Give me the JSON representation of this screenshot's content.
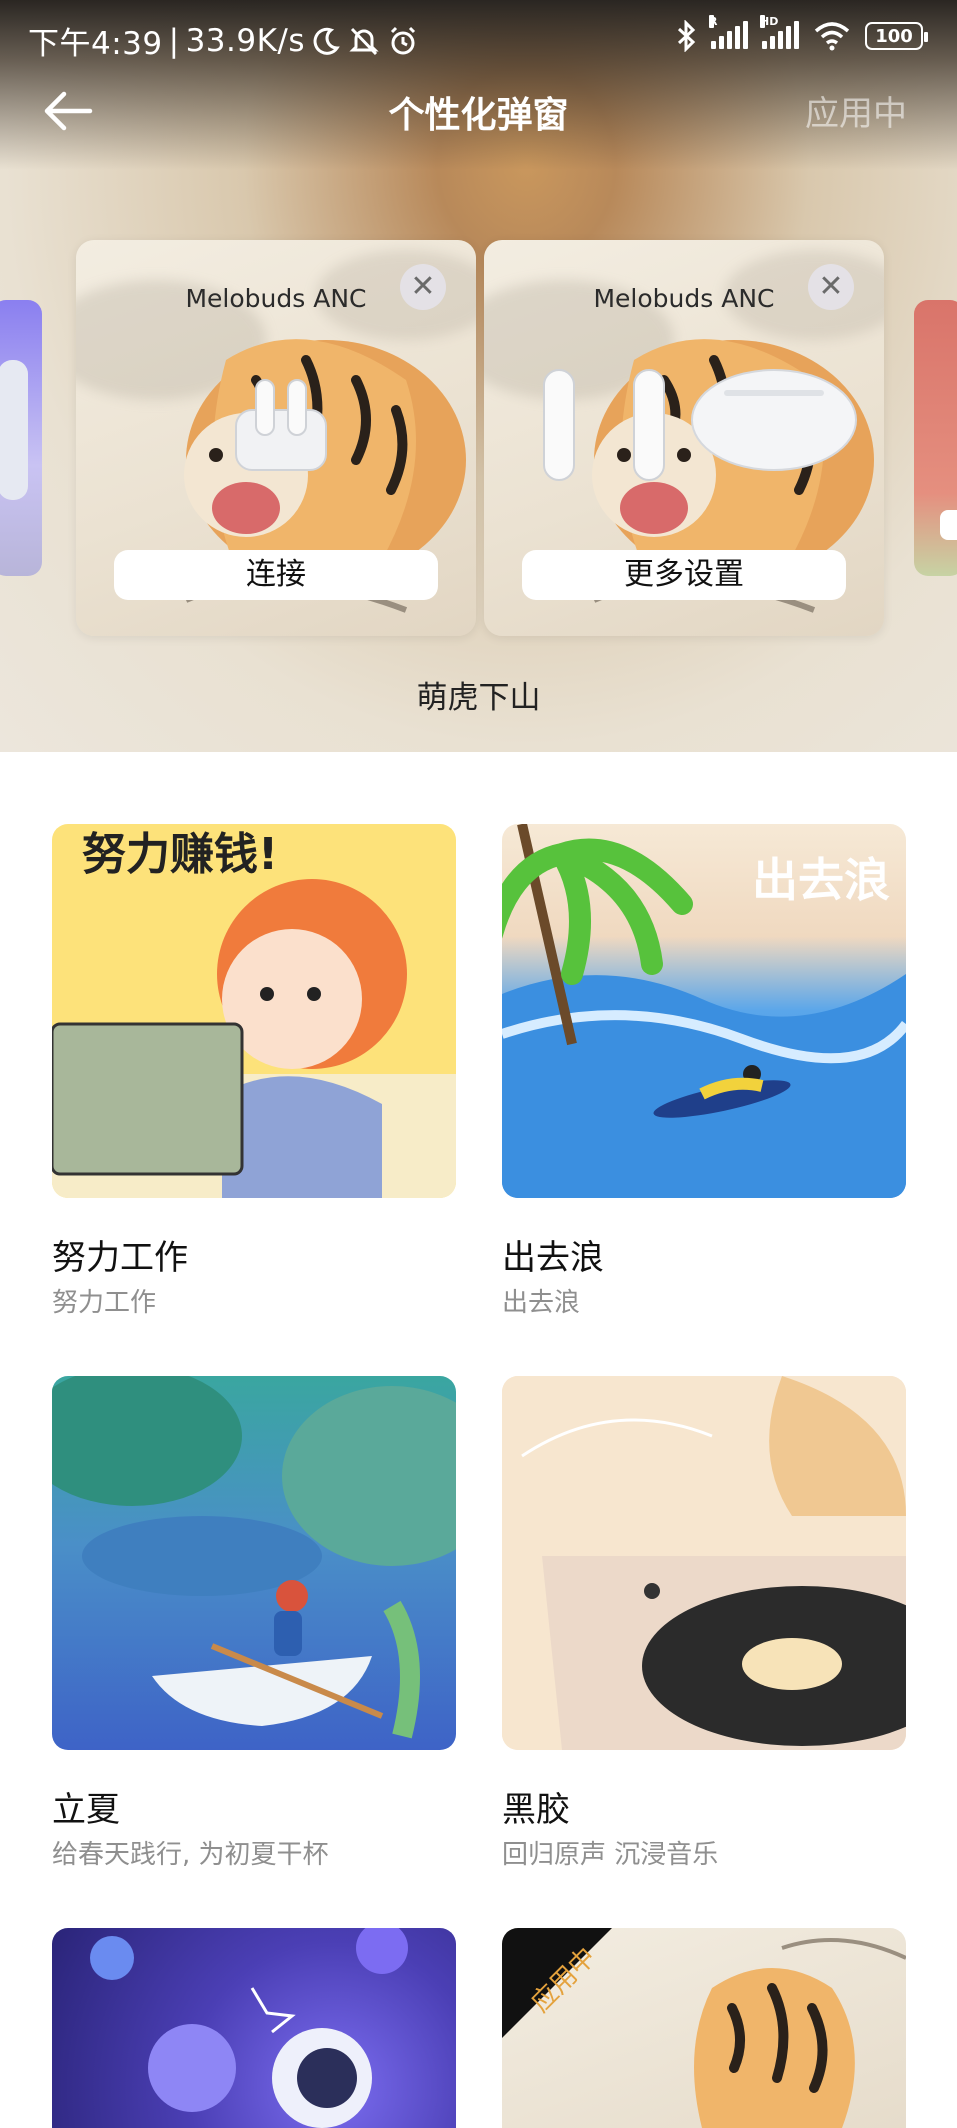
{
  "status_bar": {
    "time": "下午4:39",
    "network_speed": "33.9K/s",
    "signal1_tag": "R",
    "signal2_tag": "HD",
    "battery": "100"
  },
  "header": {
    "title": "个性化弹窗",
    "apply_label": "应用中"
  },
  "preview": {
    "cards": [
      {
        "device_name": "Melobuds ANC",
        "button_label": "连接"
      },
      {
        "device_name": "Melobuds ANC",
        "button_label": "更多设置"
      }
    ],
    "theme_name": "萌虎下山"
  },
  "themes": [
    {
      "name": "努力工作",
      "subtitle": "努力工作",
      "art_text": "努力赚钱!"
    },
    {
      "name": "出去浪",
      "subtitle": "出去浪",
      "art_text": "出去浪"
    },
    {
      "name": "立夏",
      "subtitle": "给春天践行, 为初夏干杯"
    },
    {
      "name": "黑胶",
      "subtitle": "回归原声 沉浸音乐"
    },
    {
      "name": "",
      "subtitle": ""
    },
    {
      "name": "",
      "subtitle": "",
      "badge": "应用中"
    }
  ],
  "colors": {
    "accent_yellow": "#fde27a",
    "ocean_blue": "#3b8fe0",
    "vinyl_bg": "#f5e3cc",
    "space_purple": "#4b3fb5"
  }
}
